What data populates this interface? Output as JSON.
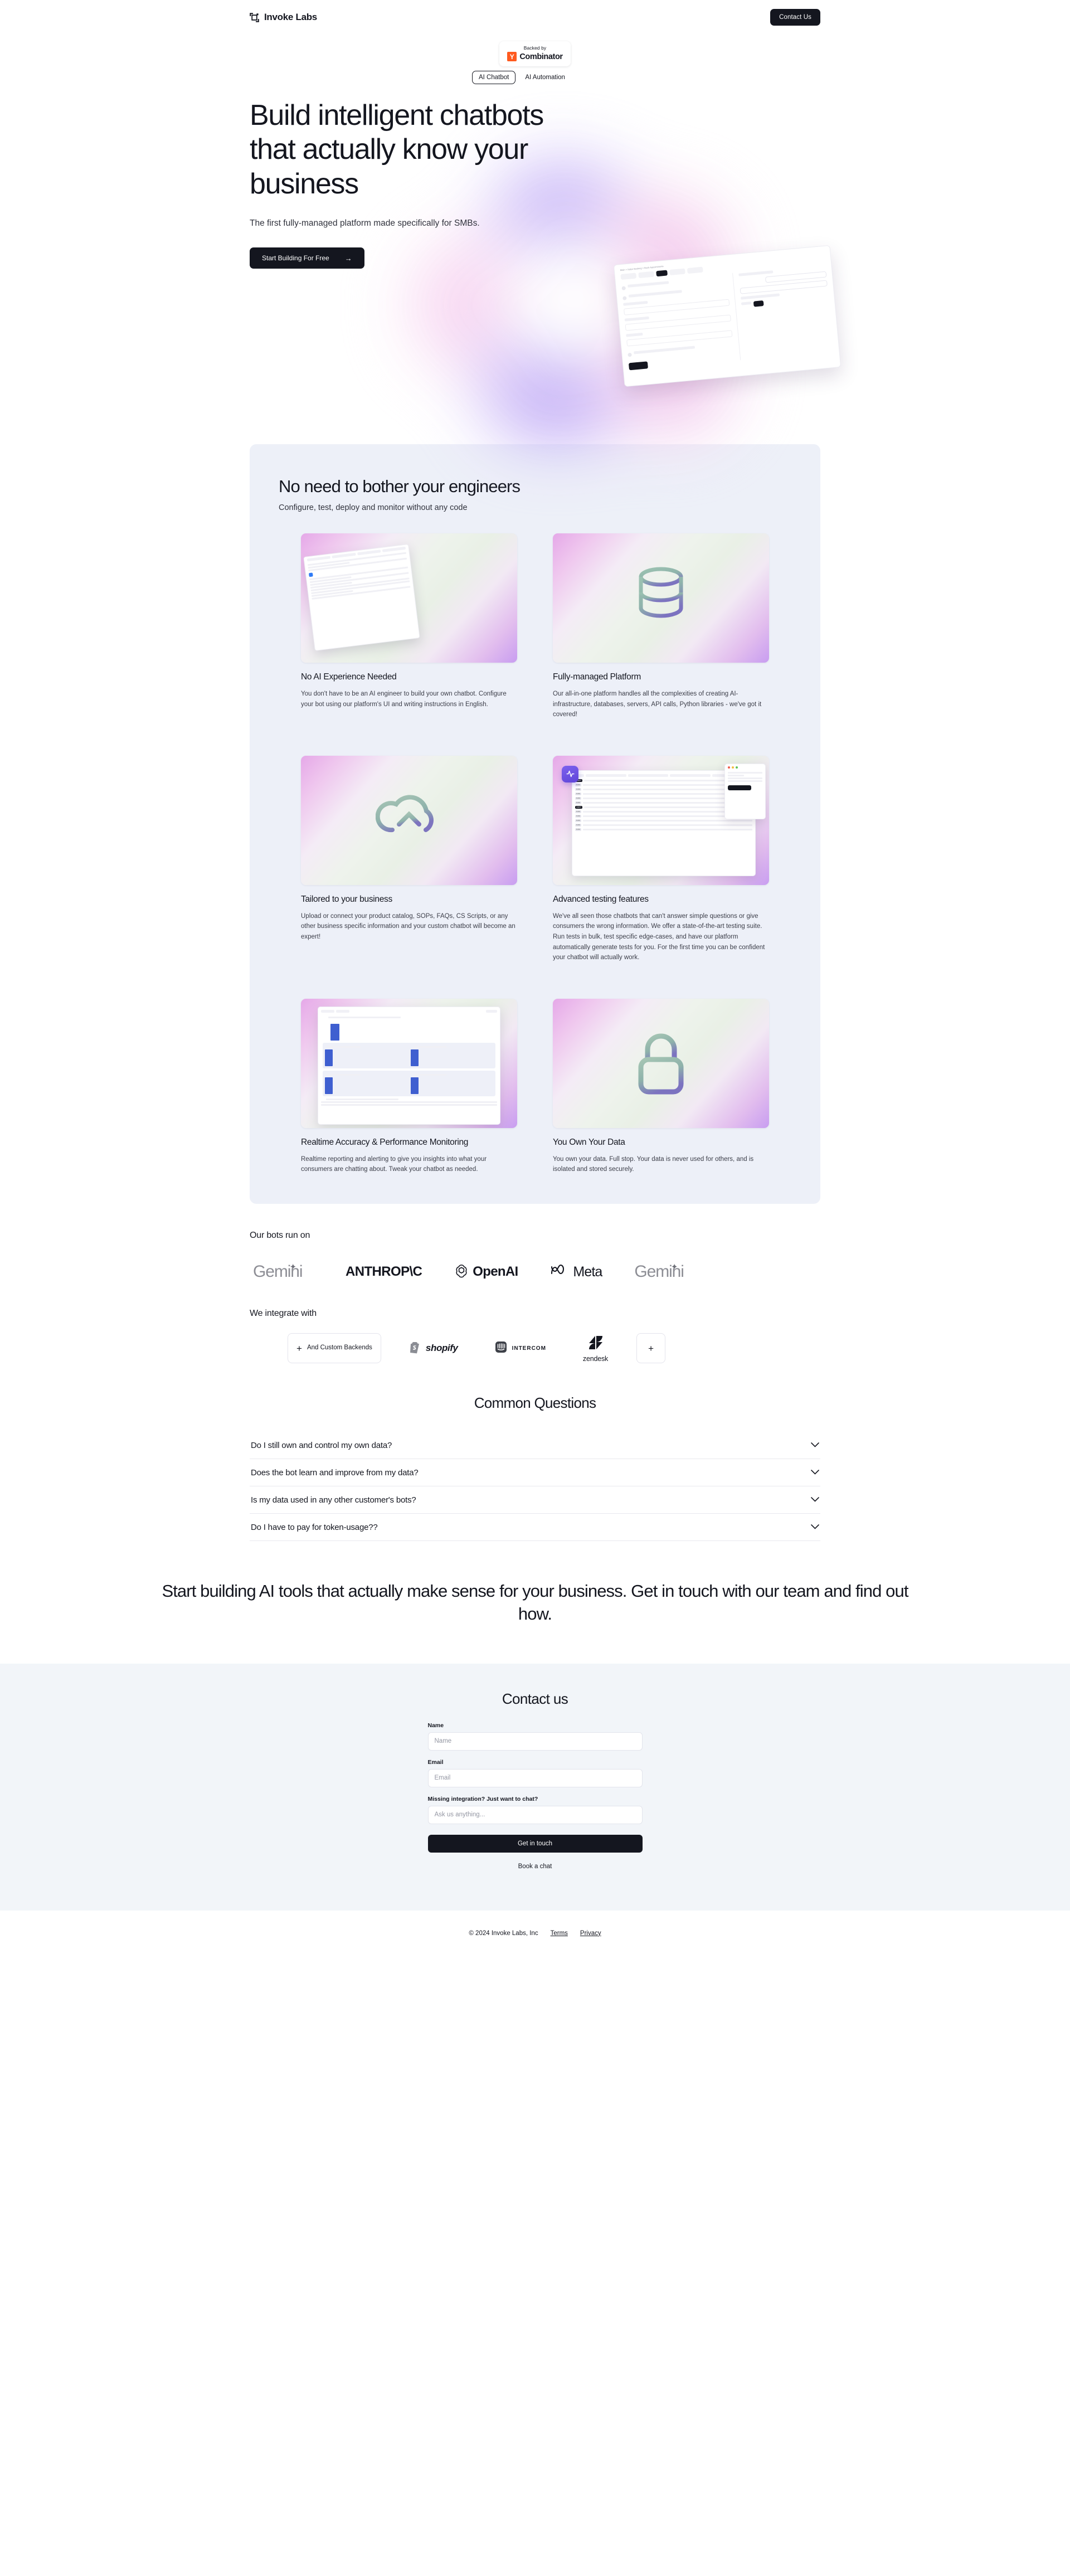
{
  "nav": {
    "brand": "Invoke Labs",
    "brand_icon": "frame-bracket-icon",
    "contact_label": "Contact Us"
  },
  "yc_badge": {
    "top_line": "Backed by",
    "mark": "Y",
    "name": "Combinator"
  },
  "hero": {
    "toggle": {
      "active": "AI Chatbot",
      "inactive": "AI Automation"
    },
    "title": "Build intelligent chatbots that actually know your business",
    "subtitle": "The first fully-managed platform made specifically for SMBs.",
    "cta_label": "Start Building For Free",
    "cta_arrow": "→",
    "screenshot": {
      "breadcrumb": "Main > Salon Booking > Book Appointments",
      "tabs": [
        "Details",
        "Test API Call",
        "Test 1",
        "Test 2",
        "Test 3"
      ],
      "checks": [
        "Test function called",
        "Test function called with arguments:",
        "Test information incorporated into response"
      ],
      "arg_fields": [
        "person_name",
        "day_of_week",
        "time"
      ],
      "arg_placeholders": [
        "Expected person_name value",
        "Expected day_of_week value",
        "Expected time value"
      ],
      "run_label": "Run test",
      "conversation_title": "Test Conversation",
      "reset_label": "Reset",
      "user_label": "User",
      "user_message": "Hey I want to book an appointment next week with Nikki",
      "message_placeholder": "Send another message",
      "send_label": "Send",
      "feedback_question": "Did this response meet expectations?",
      "feedback_yes": "Yes",
      "feedback_no": "No"
    }
  },
  "features": {
    "title": "No need to bother your engineers",
    "subtitle": "Configure, test, deploy and monitor without any code",
    "cards": [
      {
        "icon": "dashboard-screenshot-icon",
        "title": "No AI Experience Needed",
        "body": "You don't have to be an AI engineer to build your own chatbot. Configure your bot using our platform's UI and writing instructions in English."
      },
      {
        "icon": "database-icon",
        "title": "Fully-managed Platform",
        "body": "Our all-in-one platform handles all the complexities of creating AI-infrastructure, databases, servers, API calls, Python libraries - we've got it covered!"
      },
      {
        "icon": "cloud-upload-icon",
        "title": "Tailored to your business",
        "body": "Upload or connect your product catalog, SOPs, FAQs, CS Scripts, or any other business specific information and your custom chatbot will become an expert!"
      },
      {
        "icon": "testing-suite-screenshot-icon",
        "title": "Advanced testing features",
        "body": "We've all seen those chatbots that can't answer simple questions or give consumers the wrong information. We offer a state-of-the-art testing suite. Run tests in bulk, test specific edge-cases, and have our platform automatically generate tests for you. For the first time you can be confident your chatbot will actually work."
      },
      {
        "icon": "analytics-dashboard-screenshot-icon",
        "title": "Realtime Accuracy & Performance Monitoring",
        "body": "Realtime reporting and alerting to give you insights into what your consumers are chatting about. Tweak your chatbot as needed."
      },
      {
        "icon": "lock-icon",
        "title": "You Own Your Data",
        "body": "You own your data. Full stop. Your data is never used for others, and is isolated and stored securely."
      }
    ]
  },
  "models": {
    "label": "Our bots run on",
    "items": [
      {
        "name": "Gemini",
        "icon": "gemini-logo"
      },
      {
        "name": "ANTHROP\\C",
        "icon": "anthropic-logo"
      },
      {
        "name": "OpenAI",
        "icon": "openai-logo"
      },
      {
        "name": "Meta",
        "icon": "meta-logo"
      },
      {
        "name": "Gemini",
        "icon": "gemini-logo"
      }
    ]
  },
  "integrations": {
    "label": "We integrate with",
    "items": [
      {
        "name": "And Custom Backends",
        "icon": "plus-icon",
        "kind": "custom"
      },
      {
        "name": "shopify",
        "icon": "shopify-logo",
        "kind": "logo"
      },
      {
        "name": "INTERCOM",
        "icon": "intercom-logo",
        "kind": "logo"
      },
      {
        "name": "zendesk",
        "icon": "zendesk-logo",
        "kind": "logo"
      },
      {
        "name": "+",
        "icon": "plus-icon",
        "kind": "more"
      }
    ]
  },
  "faq": {
    "title": "Common Questions",
    "items": [
      {
        "question": "Do I still own and control my own data?",
        "icon": "chevron-down-icon"
      },
      {
        "question": "Does the bot learn and improve from my data?",
        "icon": "chevron-down-icon"
      },
      {
        "question": "Is my data used in any other customer's bots?",
        "icon": "chevron-down-icon"
      },
      {
        "question": "Do I have to pay for token-usage??",
        "icon": "chevron-down-icon"
      }
    ]
  },
  "cta_band": {
    "headline": "Start building AI tools that actually make sense for your business. Get in touch with our team and find out how."
  },
  "contact": {
    "title": "Contact us",
    "name_label": "Name",
    "name_placeholder": "Name",
    "name_value": "",
    "email_label": "Email",
    "email_placeholder": "Email",
    "email_value": "",
    "message_label": "Missing integration? Just want to chat?",
    "message_placeholder": "Ask us anything...",
    "message_value": "",
    "submit_label": "Get in touch",
    "book_label": "Book a chat"
  },
  "footer": {
    "copyright": "© 2024 Invoke Labs, Inc",
    "terms": "Terms",
    "privacy": "Privacy"
  },
  "colors": {
    "ink": "#14161f",
    "panel": "#edf0f8",
    "contact_bg": "#f2f5f9",
    "accent_purple": "#b49bf3",
    "accent_pink": "#efb8e8",
    "yc_orange": "#ff5a1f"
  }
}
